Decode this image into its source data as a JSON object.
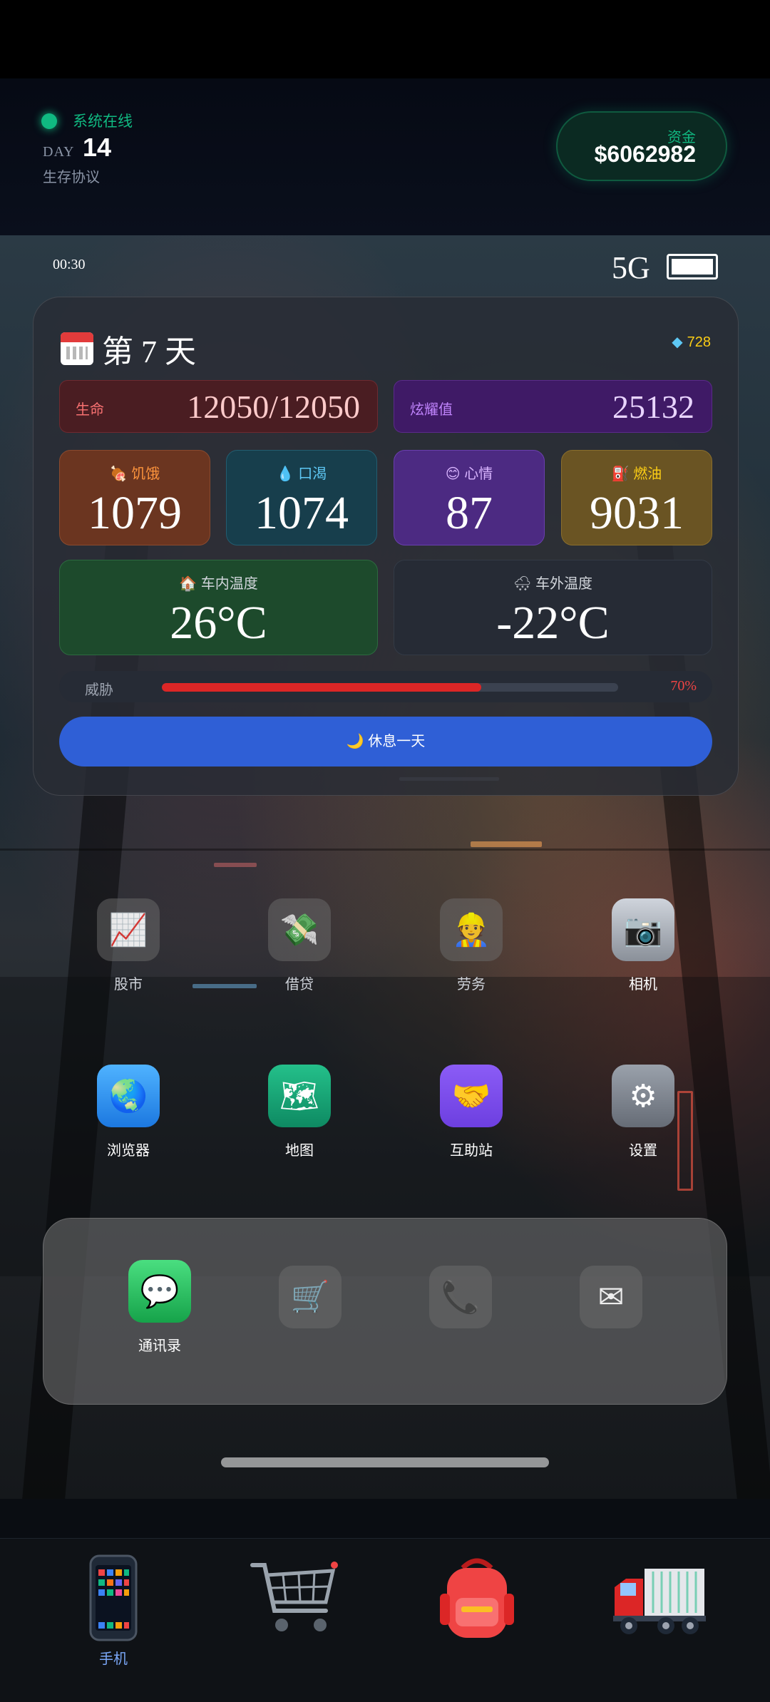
{
  "header": {
    "status_text": "系统在线",
    "day_label": "DAY",
    "day_number": "14",
    "protocol": "生存协议",
    "funds_label": "资金",
    "funds_value": "$6062982"
  },
  "status_bar": {
    "time": "00:30",
    "signal": "5G",
    "battery_level": 1.0
  },
  "panel": {
    "title": "第 7 天",
    "gems": "728",
    "life": {
      "label": "生命",
      "value": "12050/12050"
    },
    "fame": {
      "label": "炫耀值",
      "value": "25132"
    },
    "hunger": {
      "label": "饥饿",
      "value": "1079"
    },
    "thirst": {
      "label": "口渴",
      "value": "1074"
    },
    "mood": {
      "label": "心情",
      "value": "87"
    },
    "fuel": {
      "label": "燃油",
      "value": "9031"
    },
    "temp_in": {
      "label": "车内温度",
      "value": "26°C"
    },
    "temp_out": {
      "label": "车外温度",
      "value": "-22°C"
    },
    "threat": {
      "label": "威胁",
      "percent_text": "70%",
      "level": 0.7
    },
    "rest_button": "休息一天"
  },
  "apps": [
    {
      "name": "股市",
      "icon": "stock-chart-icon",
      "enabled": false
    },
    {
      "name": "借贷",
      "icon": "loan-icon",
      "enabled": false
    },
    {
      "name": "劳务",
      "icon": "worker-icon",
      "enabled": false
    },
    {
      "name": "相机",
      "icon": "camera-icon",
      "enabled": true
    },
    {
      "name": "浏览器",
      "icon": "globe-icon",
      "enabled": true
    },
    {
      "name": "地图",
      "icon": "map-icon",
      "enabled": true
    },
    {
      "name": "互助站",
      "icon": "handshake-icon",
      "enabled": true
    },
    {
      "name": "设置",
      "icon": "gear-icon",
      "enabled": true
    }
  ],
  "dock": [
    {
      "name": "通讯录",
      "icon": "message-icon",
      "enabled": true
    },
    {
      "name": "",
      "icon": "cart-icon",
      "enabled": false
    },
    {
      "name": "",
      "icon": "phone-icon",
      "enabled": false
    },
    {
      "name": "",
      "icon": "mail-icon",
      "enabled": false
    }
  ],
  "bottom_nav": [
    {
      "label": "手机",
      "icon": "phone-device-icon",
      "active": true
    },
    {
      "label": "",
      "icon": "shopping-cart-icon",
      "active": false
    },
    {
      "label": "",
      "icon": "backpack-icon",
      "active": false
    },
    {
      "label": "",
      "icon": "truck-icon",
      "active": false
    }
  ],
  "colors": {
    "online": "#10b981",
    "threat_fill": "#dc2626",
    "rest_button": "#2f5fd6",
    "nav_active": "#7aa7f7"
  }
}
